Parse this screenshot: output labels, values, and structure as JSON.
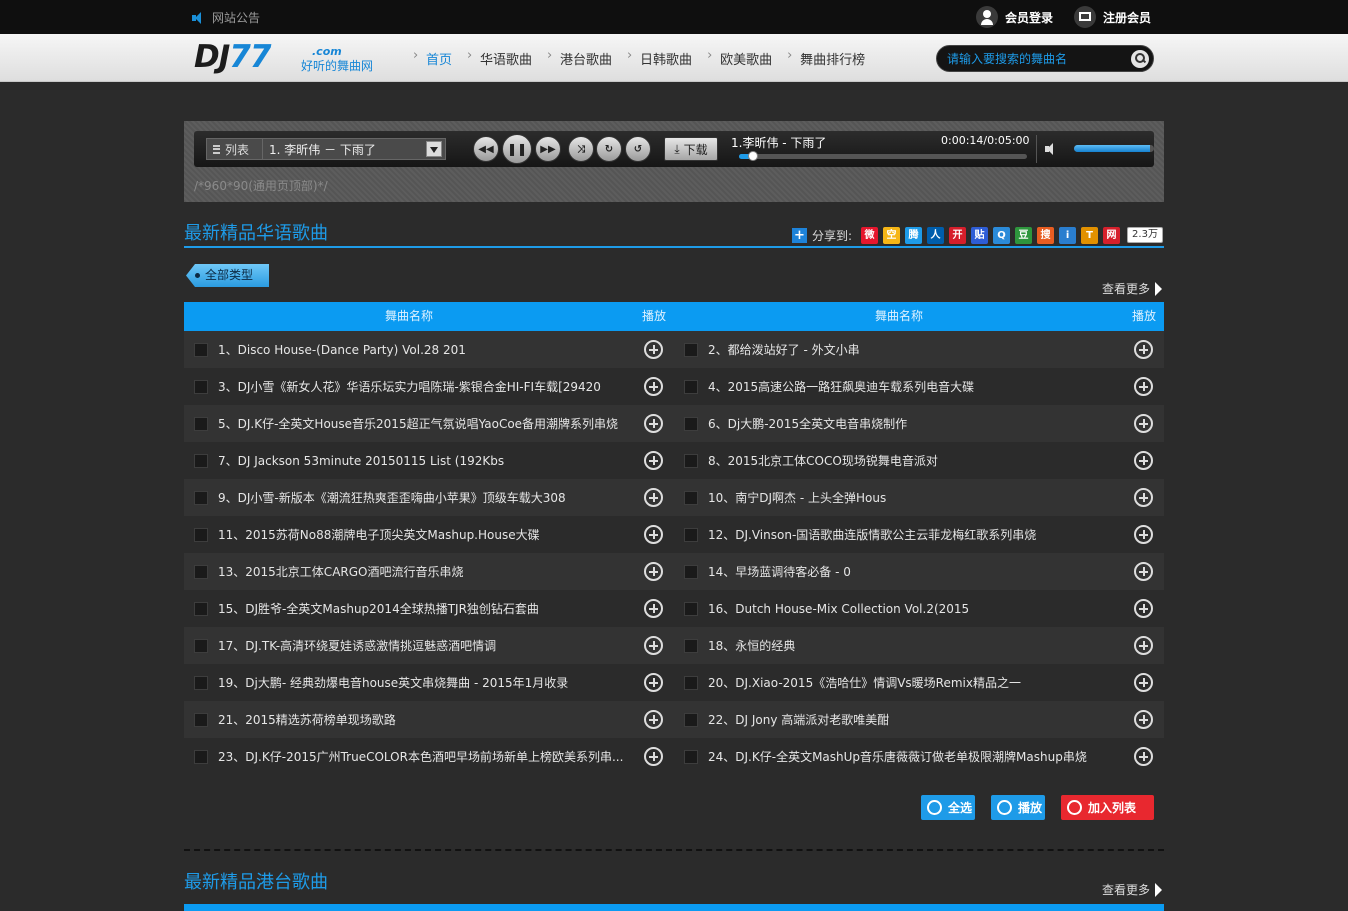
{
  "topbar": {
    "notice": "网站公告",
    "login": "会员登录",
    "register": "注册会员"
  },
  "logo": {
    "dj": "DJ",
    "num": "77",
    "com": ".com",
    "slogan": "好听的舞曲网"
  },
  "nav": {
    "items": [
      "首页",
      "华语歌曲",
      "港台歌曲",
      "日韩歌曲",
      "欧美歌曲",
      "舞曲排行榜"
    ],
    "active_index": 0
  },
  "search": {
    "placeholder": "请输入要搜索的舞曲名"
  },
  "player": {
    "list_label": "列表",
    "selected_song": "1. 李昕伟 － 下雨了",
    "controls": [
      "prev",
      "pause",
      "next",
      "shuffle",
      "repeat",
      "repeat-one"
    ],
    "download_label": "下载",
    "now_playing": "1.李昕伟 - 下雨了",
    "time": "0:00:14/0:05:00",
    "progress": 0.05,
    "volume": 0.95
  },
  "ad_text": "/*960*90(通用页顶部)*/",
  "section1": {
    "title": "最新精品华语歌曲",
    "share_label": "分享到:",
    "share_icons": [
      {
        "name": "weibo-icon",
        "glyph": "微",
        "color": "#e6162d"
      },
      {
        "name": "qzone-icon",
        "glyph": "空",
        "color": "#f6b616"
      },
      {
        "name": "tencent-weibo-icon",
        "glyph": "腾",
        "color": "#1e9be8"
      },
      {
        "name": "renren-icon",
        "glyph": "人",
        "color": "#005eac"
      },
      {
        "name": "kaixin-icon",
        "glyph": "开",
        "color": "#d61e2b"
      },
      {
        "name": "tieba-icon",
        "glyph": "贴",
        "color": "#2e5dd6"
      },
      {
        "name": "qq-icon",
        "glyph": "Q",
        "color": "#2b8bd9"
      },
      {
        "name": "douban-icon",
        "glyph": "豆",
        "color": "#2e963d"
      },
      {
        "name": "sohu-icon",
        "glyph": "搜",
        "color": "#e85d21"
      },
      {
        "name": "i-icon",
        "glyph": "i",
        "color": "#2a7ecf"
      },
      {
        "name": "t-icon",
        "glyph": "T",
        "color": "#e29100"
      },
      {
        "name": "net-icon",
        "glyph": "网",
        "color": "#d6202c"
      }
    ],
    "share_count": "2.3万",
    "type_tag": "全部类型",
    "more": "查看更多",
    "col_name": "舞曲名称",
    "col_play": "播放",
    "songs": [
      "1、Disco House-(Dance Party) Vol.28 201",
      "2、都给泼站好了 - 外文小串",
      "3、DJ小雪《新女人花》华语乐坛实力唱陈瑞-紫银合金HI-FI车载[29420",
      "4、2015高速公路一路狂飙奥迪车载系列电音大碟",
      "5、DJ.K仔-全英文House音乐2015超正气氛说唱YaoCoe备用潮牌系列串烧",
      "6、Dj大鹏-2015全英文电音串烧制作",
      "7、DJ Jackson 53minute 20150115 List (192Kbs",
      "8、2015北京工体COCO现场锐舞电音派对",
      "9、DJ小雪-新版本《潮流狂热爽歪歪嗨曲小苹果》顶级车载大308",
      "10、南宁DJ啊杰 - 上头全弹Hous",
      "11、2015苏荷No88潮牌电子顶尖英文Mashup.House大碟",
      "12、DJ.Vinson-国语歌曲连版情歌公主云菲龙梅红歌系列串烧",
      "13、2015北京工体CARGO酒吧流行音乐串烧",
      "14、早场蓝调待客必备 - 0",
      "15、DJ胜爷-全英文Mashup2014全球热播TJR独创钻石套曲",
      "16、Dutch House-Mix Collection Vol.2(2015",
      "17、DJ.TK-高清环绕夏娃诱惑激情挑逗魅惑酒吧情调",
      "18、永恒的经典",
      "19、Dj大鹏- 经典劲爆电音house英文串烧舞曲 - 2015年1月收录",
      "20、DJ.Xiao-2015《浩哈仕》情调Vs暖场Remix精品之一",
      "21、2015精选苏荷榜单现场歌路",
      "22、DJ Jony 高端派对老歌唯美酣",
      "23、DJ.K仔-2015广州TrueCOLOR本色酒吧早场前场新单上榜欧美系列串...",
      "24、DJ.K仔-全英文MashUp音乐唐薇薇订做老单极限潮牌Mashup串烧"
    ],
    "select_all": "全选",
    "play": "播放",
    "add_list": "加入列表"
  },
  "section2": {
    "title": "最新精品港台歌曲",
    "more": "查看更多"
  },
  "colors": {
    "accent": "#1e9be8",
    "header_blue": "#0b9bf2",
    "add_red": "#e8282f"
  }
}
